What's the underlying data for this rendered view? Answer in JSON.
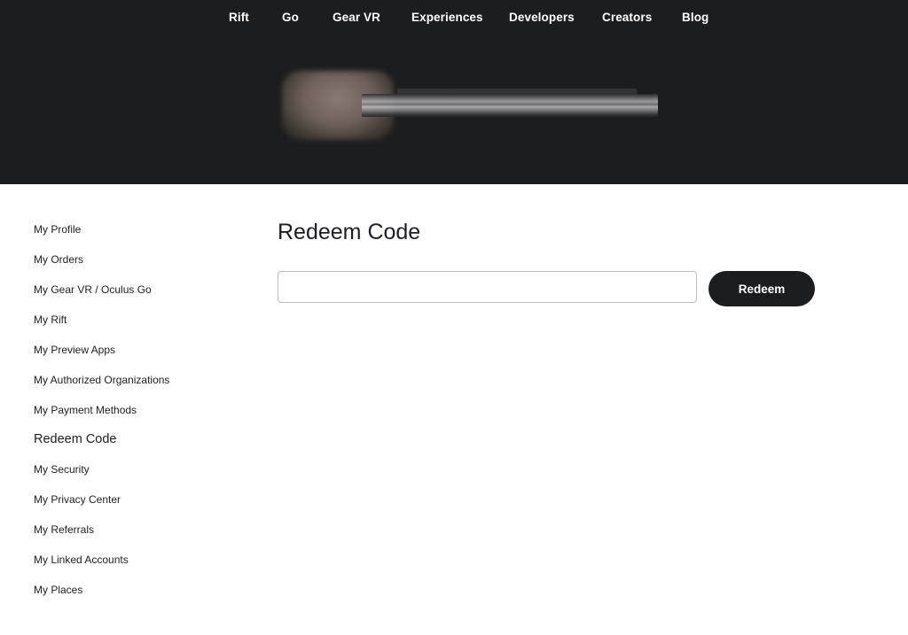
{
  "nav": {
    "items": [
      {
        "label": "Rift"
      },
      {
        "label": "Go"
      },
      {
        "label": "Gear VR"
      },
      {
        "label": "Experiences"
      },
      {
        "label": "Developers"
      },
      {
        "label": "Creators"
      },
      {
        "label": "Blog"
      }
    ]
  },
  "colors": {
    "header_bg": "#1c1d1f",
    "button_bg": "#1c1d1f",
    "text": "#1c1e21",
    "input_border": "#b9bcc0"
  },
  "sidebar": {
    "items": [
      {
        "label": "My Profile"
      },
      {
        "label": "My Orders"
      },
      {
        "label": "My Gear VR / Oculus Go"
      },
      {
        "label": "My Rift"
      },
      {
        "label": "My Preview Apps"
      },
      {
        "label": "My Authorized Organizations"
      },
      {
        "label": "My Payment Methods"
      },
      {
        "label": "Redeem Code"
      },
      {
        "label": "My Security"
      },
      {
        "label": "My Privacy Center"
      },
      {
        "label": "My Referrals"
      },
      {
        "label": "My Linked Accounts"
      },
      {
        "label": "My Places"
      }
    ],
    "active": "Redeem Code"
  },
  "main": {
    "title": "Redeem Code",
    "code_input": {
      "value": "",
      "placeholder": ""
    },
    "redeem_label": "Redeem"
  }
}
